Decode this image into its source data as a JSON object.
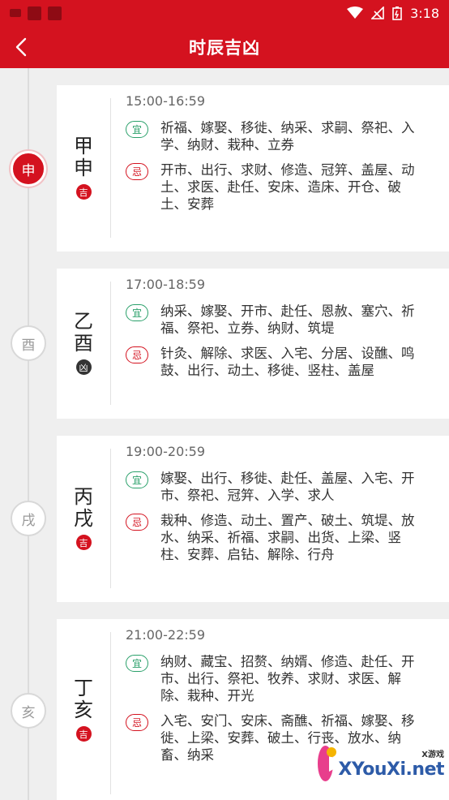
{
  "status_bar": {
    "time": "3:18",
    "icons": [
      "notification-square-icon",
      "app-square-icon",
      "app-square-icon",
      "wifi-icon",
      "no-signal-icon",
      "battery-icon"
    ]
  },
  "header": {
    "title": "时辰吉凶",
    "back_icon": "chevron-left-icon"
  },
  "periods": [
    {
      "branch": "申",
      "ganzhi": "甲申",
      "ganzhi_lines": [
        "甲",
        "申"
      ],
      "fortune": "吉",
      "time": "15:00-16:59",
      "yi_label": "宜",
      "yi": [
        "祈福、嫁娶、移徙、纳采、求嗣、祭祀、入",
        "学、纳财、栽种、立券"
      ],
      "ji_label": "忌",
      "ji": [
        "开市、出行、求财、修造、冠笄、盖屋、动",
        "土、求医、赴任、安床、造床、开仓、破",
        "土、安葬"
      ],
      "active": true
    },
    {
      "branch": "酉",
      "ganzhi": "乙酉",
      "ganzhi_lines": [
        "乙",
        "酉"
      ],
      "fortune": "凶",
      "time": "17:00-18:59",
      "yi_label": "宜",
      "yi": [
        "纳采、嫁娶、开市、赴任、恩赦、塞穴、祈",
        "福、祭祀、立券、纳财、筑堤"
      ],
      "ji_label": "忌",
      "ji": [
        "针灸、解除、求医、入宅、分居、设醮、鸣",
        "鼓、出行、动土、移徙、竖柱、盖屋"
      ],
      "active": false
    },
    {
      "branch": "戌",
      "ganzhi": "丙戌",
      "ganzhi_lines": [
        "丙",
        "戌"
      ],
      "fortune": "吉",
      "time": "19:00-20:59",
      "yi_label": "宜",
      "yi": [
        "嫁娶、出行、移徙、赴任、盖屋、入宅、开",
        "市、祭祀、冠笄、入学、求人"
      ],
      "ji_label": "忌",
      "ji": [
        "栽种、修造、动土、置产、破土、筑堤、放",
        "水、纳采、祈福、求嗣、出货、上梁、竖",
        "柱、安葬、启钻、解除、行舟"
      ],
      "active": false
    },
    {
      "branch": "亥",
      "ganzhi": "丁亥",
      "ganzhi_lines": [
        "丁",
        "亥"
      ],
      "fortune": "吉",
      "time": "21:00-22:59",
      "yi_label": "宜",
      "yi": [
        "纳财、藏宝、招赘、纳婿、修造、赴任、开",
        "市、出行、祭祀、牧养、求财、求医、解",
        "除、栽种、开光"
      ],
      "ji_label": "忌",
      "ji": [
        "入宅、安门、安床、斋醮、祈福、嫁娶、移",
        "徙、上梁、安葬、破土、行丧、放水、纳",
        "畜、纳采"
      ],
      "active": false
    }
  ],
  "watermark": {
    "sub": "X游戏",
    "main": "XYouXi.net"
  },
  "colors": {
    "brand_red": "#d4121f",
    "yi_green": "#2aa06a",
    "ji_red": "#d4121f",
    "bad_badge": "#333333"
  }
}
